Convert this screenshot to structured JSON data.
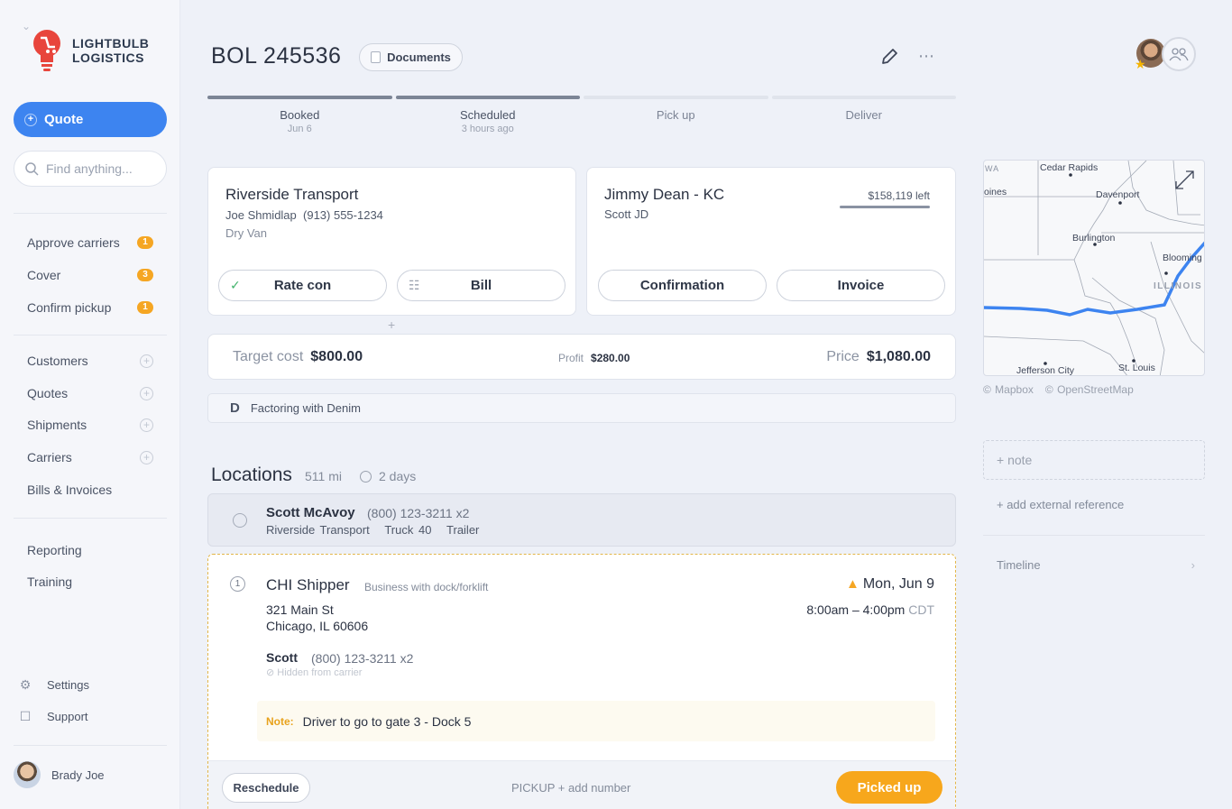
{
  "sidebar": {
    "brand_line1": "LIGHTBULB",
    "brand_line2": "LOGISTICS",
    "quote_label": "Quote",
    "search_placeholder": "Find anything...",
    "tasks": [
      {
        "label": "Approve carriers",
        "count": "1"
      },
      {
        "label": "Cover",
        "count": "3"
      },
      {
        "label": "Confirm pickup",
        "count": "1"
      }
    ],
    "sections": [
      {
        "label": "Customers"
      },
      {
        "label": "Quotes"
      },
      {
        "label": "Shipments"
      },
      {
        "label": "Carriers"
      },
      {
        "label": "Bills & Invoices"
      }
    ],
    "extras": [
      {
        "label": "Reporting"
      },
      {
        "label": "Training"
      }
    ],
    "settings_label": "Settings",
    "support_label": "Support",
    "user_name": "Brady Joe"
  },
  "header": {
    "title": "BOL 245536",
    "documents_label": "Documents"
  },
  "progress": [
    {
      "label": "Booked",
      "sub": "Jun 6"
    },
    {
      "label": "Scheduled",
      "sub": "3 hours ago"
    },
    {
      "label": "Pick up",
      "sub": ""
    },
    {
      "label": "Deliver",
      "sub": ""
    }
  ],
  "carrier": {
    "name": "Riverside Transport",
    "contact": "Joe Shmidlap",
    "phone": "(913) 555-1234",
    "equipment": "Dry Van",
    "rate_con_label": "Rate con",
    "bill_label": "Bill"
  },
  "customer": {
    "name": "Jimmy Dean - KC",
    "contact": "Scott JD",
    "credit_left": "$158,119 left",
    "confirmation_label": "Confirmation",
    "invoice_label": "Invoice"
  },
  "costs": {
    "target_label": "Target cost",
    "target_value": "$800.00",
    "profit_label": "Profit",
    "profit_value": "$280.00",
    "price_label": "Price",
    "price_value": "$1,080.00"
  },
  "factoring_label": "Factoring with Denim",
  "locations": {
    "title": "Locations",
    "distance": "511 mi",
    "duration": "2 days",
    "driver": {
      "name": "Scott McAvoy",
      "phone": "(800) 123-3211 x2",
      "company": "Riverside Transport",
      "truck": "Truck 40",
      "trailer": "Trailer"
    },
    "stop": {
      "number": "1",
      "name": "CHI Shipper",
      "type": "Business with dock/forklift",
      "date": "Mon, Jun 9",
      "hours": "8:00am – 4:00pm",
      "tz": "CDT",
      "address1": "321 Main St",
      "address2": "Chicago, IL 60606",
      "contact": "Scott",
      "contact_phone": "(800) 123-3211 x2",
      "hidden_note": "Hidden from carrier",
      "note_label": "Note:",
      "note_text": "Driver to go to gate 3 - Dock 5",
      "reschedule_label": "Reschedule",
      "pickup_number": "PICKUP + add number",
      "picked_up_label": "Picked up"
    }
  },
  "map": {
    "labels": [
      "WA",
      "Cedar Rapids",
      "oines",
      "Davenport",
      "Burlington",
      "Blooming",
      "ILLINOIS",
      "Jefferson City",
      "St. Louis"
    ],
    "credit1": "© Mapbox",
    "credit2": "© OpenStreetMap"
  },
  "right": {
    "note_label": "+ note",
    "ext_ref_label": "+ add external reference",
    "timeline_label": "Timeline"
  },
  "colors": {
    "accent": "#3d84f0",
    "warning": "#f5a623",
    "picked_up": "#f7a71c"
  }
}
